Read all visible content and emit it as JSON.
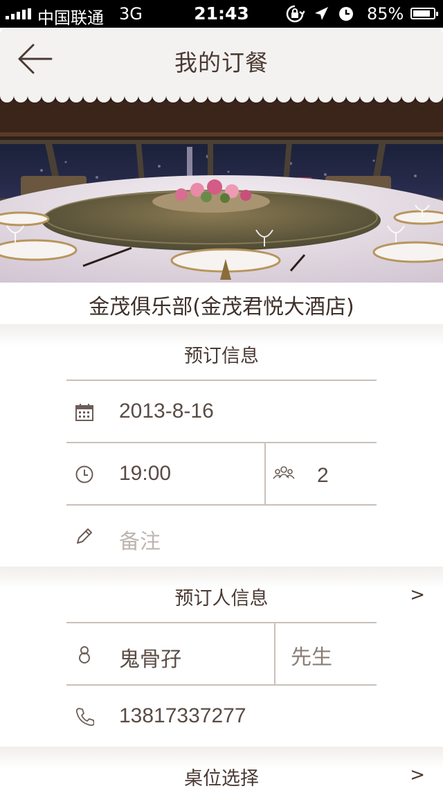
{
  "status_bar": {
    "carrier": "中国联通",
    "network": "3G",
    "time": "21:43",
    "battery": "85%",
    "battery_level": 0.85
  },
  "nav": {
    "title": "我的订餐"
  },
  "restaurant": {
    "name": "金茂俱乐部(金茂君悦大酒店)"
  },
  "booking_info": {
    "header": "预订信息",
    "date": "2013-8-16",
    "time": "19:00",
    "guests": "2",
    "note_placeholder": "备注"
  },
  "booker_info": {
    "header": "预订人信息",
    "chevron": ">",
    "name": "鬼骨孖",
    "title": "先生",
    "phone": "13817337277"
  },
  "table_selection": {
    "header": "桌位选择",
    "chevron": ">"
  }
}
